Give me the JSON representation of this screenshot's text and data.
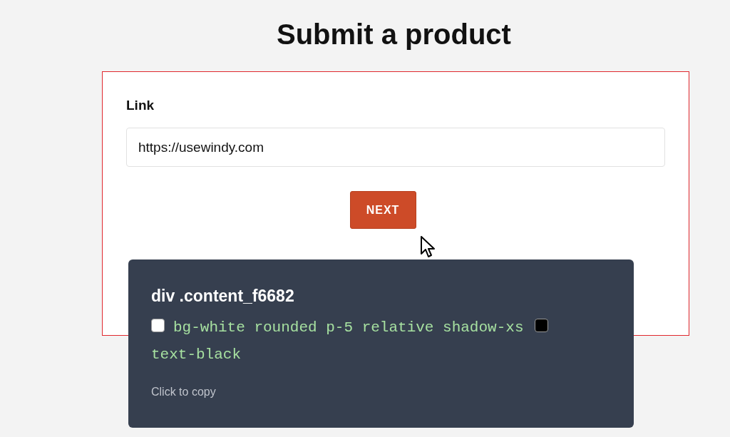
{
  "page": {
    "title": "Submit a product"
  },
  "form": {
    "label": "Link",
    "value": "https://usewindy.com",
    "button": "NEXT",
    "highlighted": true
  },
  "tooltip": {
    "title": "div .content_f6682",
    "classes": [
      {
        "kind": "swatch",
        "color": "#ffffff"
      },
      {
        "kind": "text",
        "text": "bg-white rounded p-5 relative shadow-xs"
      },
      {
        "kind": "swatch",
        "color": "#000000"
      },
      {
        "kind": "text",
        "text": "text-black"
      }
    ],
    "hint": "Click to copy"
  }
}
